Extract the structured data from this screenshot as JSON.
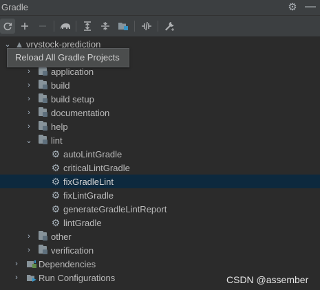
{
  "panel": {
    "title": "Gradle",
    "gear_icon": "gear-icon",
    "hide_icon": "minus-icon"
  },
  "toolbar": {
    "buttons": [
      {
        "name": "reload-all-button",
        "icon": "refresh-icon",
        "state": "active"
      },
      {
        "name": "link-project-button",
        "icon": "plus-icon",
        "state": "enabled"
      },
      {
        "name": "unlink-project-button",
        "icon": "minus-icon",
        "state": "disabled"
      },
      {
        "name": "execute-task-button",
        "icon": "elephant-icon",
        "state": "enabled"
      },
      {
        "name": "expand-all-button",
        "icon": "expand-all-icon",
        "state": "enabled"
      },
      {
        "name": "collapse-all-button",
        "icon": "collapse-all-icon",
        "state": "enabled"
      },
      {
        "name": "dependencies-button",
        "icon": "dependencies-icon",
        "state": "enabled"
      },
      {
        "name": "toggle-offline-button",
        "icon": "offline-icon",
        "state": "enabled"
      },
      {
        "name": "build-settings-button",
        "icon": "wrench-icon",
        "state": "enabled"
      }
    ]
  },
  "tooltip": {
    "text": "Reload All Gradle Projects"
  },
  "tree": {
    "root": {
      "label": "vrystock-prediction",
      "expanded": true
    },
    "groups": [
      {
        "label": "application",
        "expanded": false
      },
      {
        "label": "build",
        "expanded": false
      },
      {
        "label": "build setup",
        "expanded": false
      },
      {
        "label": "documentation",
        "expanded": false
      },
      {
        "label": "help",
        "expanded": false
      },
      {
        "label": "lint",
        "expanded": true
      },
      {
        "label": "other",
        "expanded": false
      },
      {
        "label": "verification",
        "expanded": false
      }
    ],
    "lint_tasks": [
      {
        "label": "autoLintGradle"
      },
      {
        "label": "criticalLintGradle"
      },
      {
        "label": "fixGradleLint",
        "selected": true
      },
      {
        "label": "fixLintGradle"
      },
      {
        "label": "generateGradleLintReport"
      },
      {
        "label": "lintGradle"
      }
    ],
    "bottom": [
      {
        "label": "Dependencies",
        "icon": "dependencies-icon"
      },
      {
        "label": "Run Configurations",
        "icon": "run-configurations-icon"
      }
    ]
  },
  "watermark": {
    "text": "CSDN @assember"
  },
  "colors": {
    "background": "#2b2b2b",
    "toolbar": "#3c3f41",
    "selection": "#0d293e",
    "text": "#bbbbbb"
  }
}
